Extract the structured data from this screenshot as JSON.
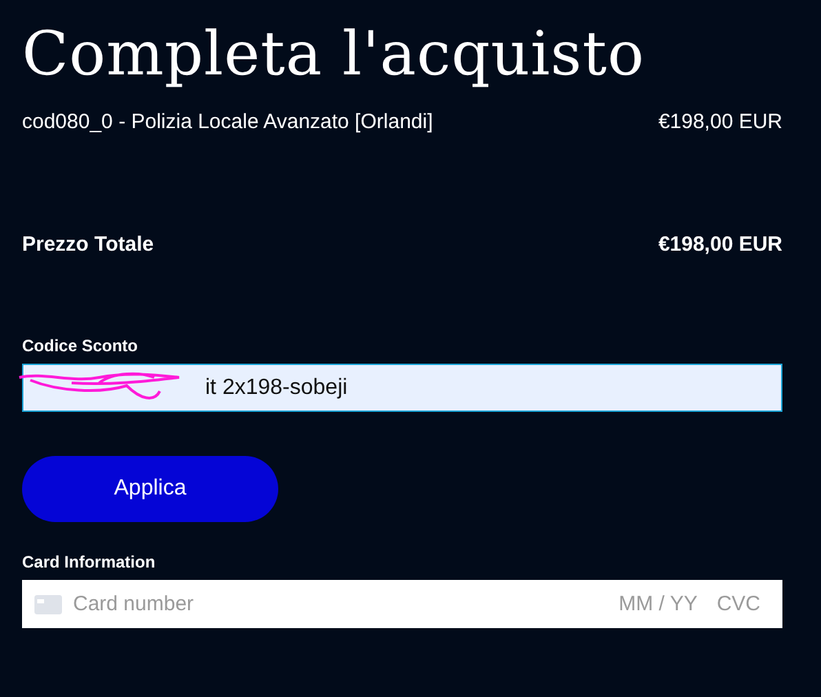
{
  "title": "Completa l'acquisto",
  "items": [
    {
      "name": "cod080_0 - Polizia Locale Avanzato [Orlandi]",
      "price": "€198,00 EUR"
    }
  ],
  "total": {
    "label": "Prezzo Totale",
    "price": "€198,00 EUR"
  },
  "discount": {
    "label": "Codice Sconto",
    "value": "it 2x198-sobeji",
    "button": "Applica"
  },
  "card": {
    "label": "Card Information",
    "placeholder": "Card number",
    "expiry": "MM / YY",
    "cvc": "CVC"
  }
}
